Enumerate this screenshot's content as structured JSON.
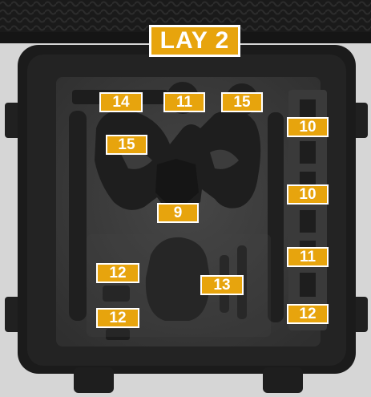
{
  "title": "LAY 2",
  "labels": [
    "14",
    "11",
    "15",
    "10",
    "15",
    "10",
    "9",
    "11",
    "12",
    "13",
    "12",
    "12"
  ],
  "colors": {
    "tag_fill": "#e7a40d",
    "tag_text": "#ffffff",
    "case_body": "#1c1c1c",
    "foam_dark": "#252525",
    "foam_panel": "#3c3c3c",
    "background": "#d8d8d8"
  }
}
